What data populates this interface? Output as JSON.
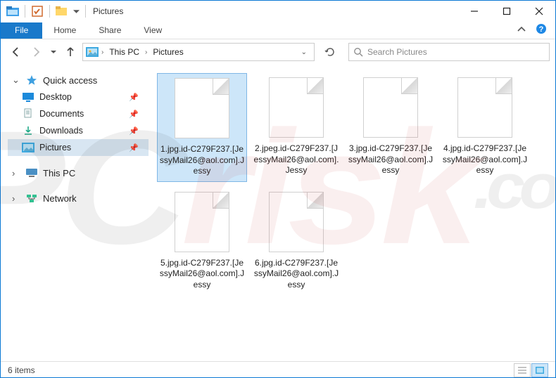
{
  "window": {
    "title": "Pictures"
  },
  "ribbon": {
    "file": "File",
    "tabs": [
      "Home",
      "Share",
      "View"
    ]
  },
  "breadcrumb": {
    "segments": [
      "This PC",
      "Pictures"
    ]
  },
  "search": {
    "placeholder": "Search Pictures"
  },
  "nav": {
    "quick_access": {
      "label": "Quick access",
      "items": [
        {
          "label": "Desktop",
          "icon": "desktop"
        },
        {
          "label": "Documents",
          "icon": "documents"
        },
        {
          "label": "Downloads",
          "icon": "downloads"
        },
        {
          "label": "Pictures",
          "icon": "pictures",
          "selected": true
        }
      ]
    },
    "this_pc": {
      "label": "This PC"
    },
    "network": {
      "label": "Network"
    }
  },
  "files": [
    {
      "name": "1.jpg.id-C279F237.[JessyMail26@aol.com].Jessy",
      "selected": true
    },
    {
      "name": "2.jpeg.id-C279F237.[JessyMail26@aol.com].Jessy"
    },
    {
      "name": "3.jpg.id-C279F237.[JessyMail26@aol.com].Jessy"
    },
    {
      "name": "4.jpg.id-C279F237.[JessyMail26@aol.com].Jessy"
    },
    {
      "name": "5.jpg.id-C279F237.[JessyMail26@aol.com].Jessy"
    },
    {
      "name": "6.jpg.id-C279F237.[JessyMail26@aol.com].Jessy"
    }
  ],
  "status": {
    "count": "6 items"
  },
  "watermark": {
    "a": "PC",
    "b": "risk",
    "c": ".com"
  }
}
